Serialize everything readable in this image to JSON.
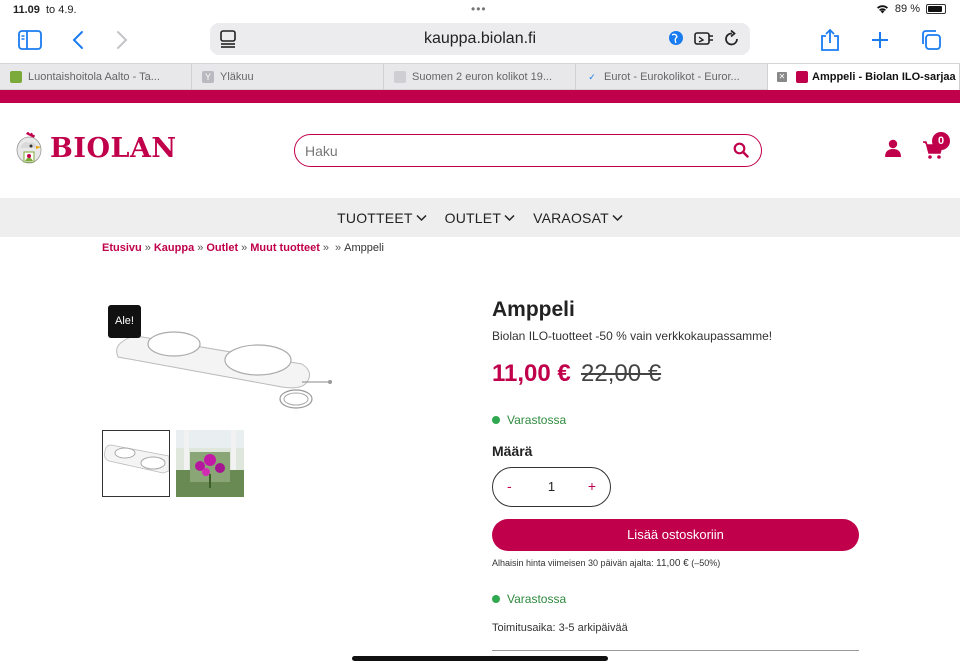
{
  "status": {
    "time": "11.09",
    "date": "to 4.9.",
    "dots": "•••",
    "battery": "89 %",
    "battery_level": 0.89
  },
  "toolbar": {
    "url": "kauppa.biolan.fi"
  },
  "tabs": [
    {
      "label": "Luontaishoitola Aalto - Ta...",
      "fav_color": "#7caa3a",
      "fav_char": ""
    },
    {
      "label": "Yläkuu",
      "fav_color": "#b9b9bf",
      "fav_char": "Y"
    },
    {
      "label": "Suomen 2 euron kolikot 19...",
      "fav_color": "#cfcfd3",
      "fav_char": ""
    },
    {
      "label": "Eurot - Eurokolikot - Euror...",
      "fav_color": "#e8e8ea",
      "fav_char": "✓"
    },
    {
      "label": "Amppeli - Biolan ILO-sarjaa",
      "fav_color": "#c0004b",
      "fav_char": ""
    }
  ],
  "header": {
    "logo_text": "BIOLAN",
    "search_placeholder": "Haku",
    "cart_count": "0"
  },
  "nav": {
    "items": [
      "TUOTTEET",
      "OUTLET",
      "VARAOSAT"
    ]
  },
  "breadcrumb": {
    "items": [
      "Etusivu",
      "Kauppa",
      "Outlet",
      "Muut tuotteet"
    ],
    "current": "Amppeli"
  },
  "gallery": {
    "badge": "Ale!"
  },
  "product": {
    "title": "Amppeli",
    "subtitle": "Biolan ILO-tuotteet -50 % vain verkkokaupassamme!",
    "price": "11,00 €",
    "old_price": "22,00 €",
    "stock": "Varastossa",
    "qty_label": "Määrä",
    "qty_minus": "-",
    "qty_value": "1",
    "qty_plus": "+",
    "add_to_cart": "Lisää ostoskoriin",
    "lowest_price_text": "Alhaisin hinta viimeisen 30 päivän ajalta:",
    "lowest_price_value": "11,00 €",
    "lowest_price_pct": "(–50%)",
    "stock2": "Varastossa",
    "delivery": "Toimitusaika: 3-5 arkipäivää"
  },
  "colors": {
    "brand": "#c0004b",
    "stock_green": "#2fa84f",
    "safari_blue": "#1a7cf0"
  }
}
